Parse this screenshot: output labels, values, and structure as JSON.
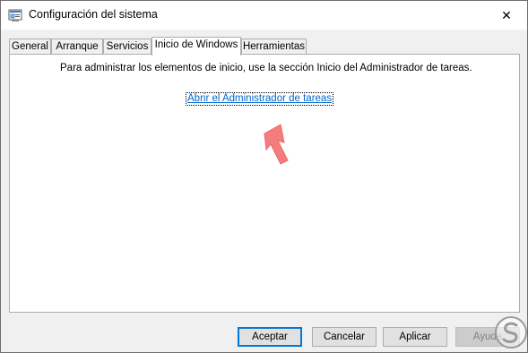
{
  "window": {
    "title": "Configuración del sistema",
    "close_glyph": "✕"
  },
  "tabs": [
    {
      "label": "General",
      "active": false
    },
    {
      "label": "Arranque",
      "active": false
    },
    {
      "label": "Servicios",
      "active": false
    },
    {
      "label": "Inicio de Windows",
      "active": true
    },
    {
      "label": "Herramientas",
      "active": false
    }
  ],
  "panel": {
    "info_text": "Para administrar los elementos de inicio, use la sección Inicio del Administrador de tareas.",
    "link_text": "Abrir el Administrador de tareas"
  },
  "buttons": {
    "accept": "Aceptar",
    "cancel": "Cancelar",
    "apply": "Aplicar",
    "help": "Ayuda"
  },
  "colors": {
    "link": "#0066cc",
    "arrow": "#f47c7c",
    "default_button_border": "#0078d7"
  },
  "icons": {
    "app": "msconfig-icon",
    "close": "close-icon",
    "annotation": "red-arrow-icon",
    "watermark": "solvetic-logo-icon"
  }
}
